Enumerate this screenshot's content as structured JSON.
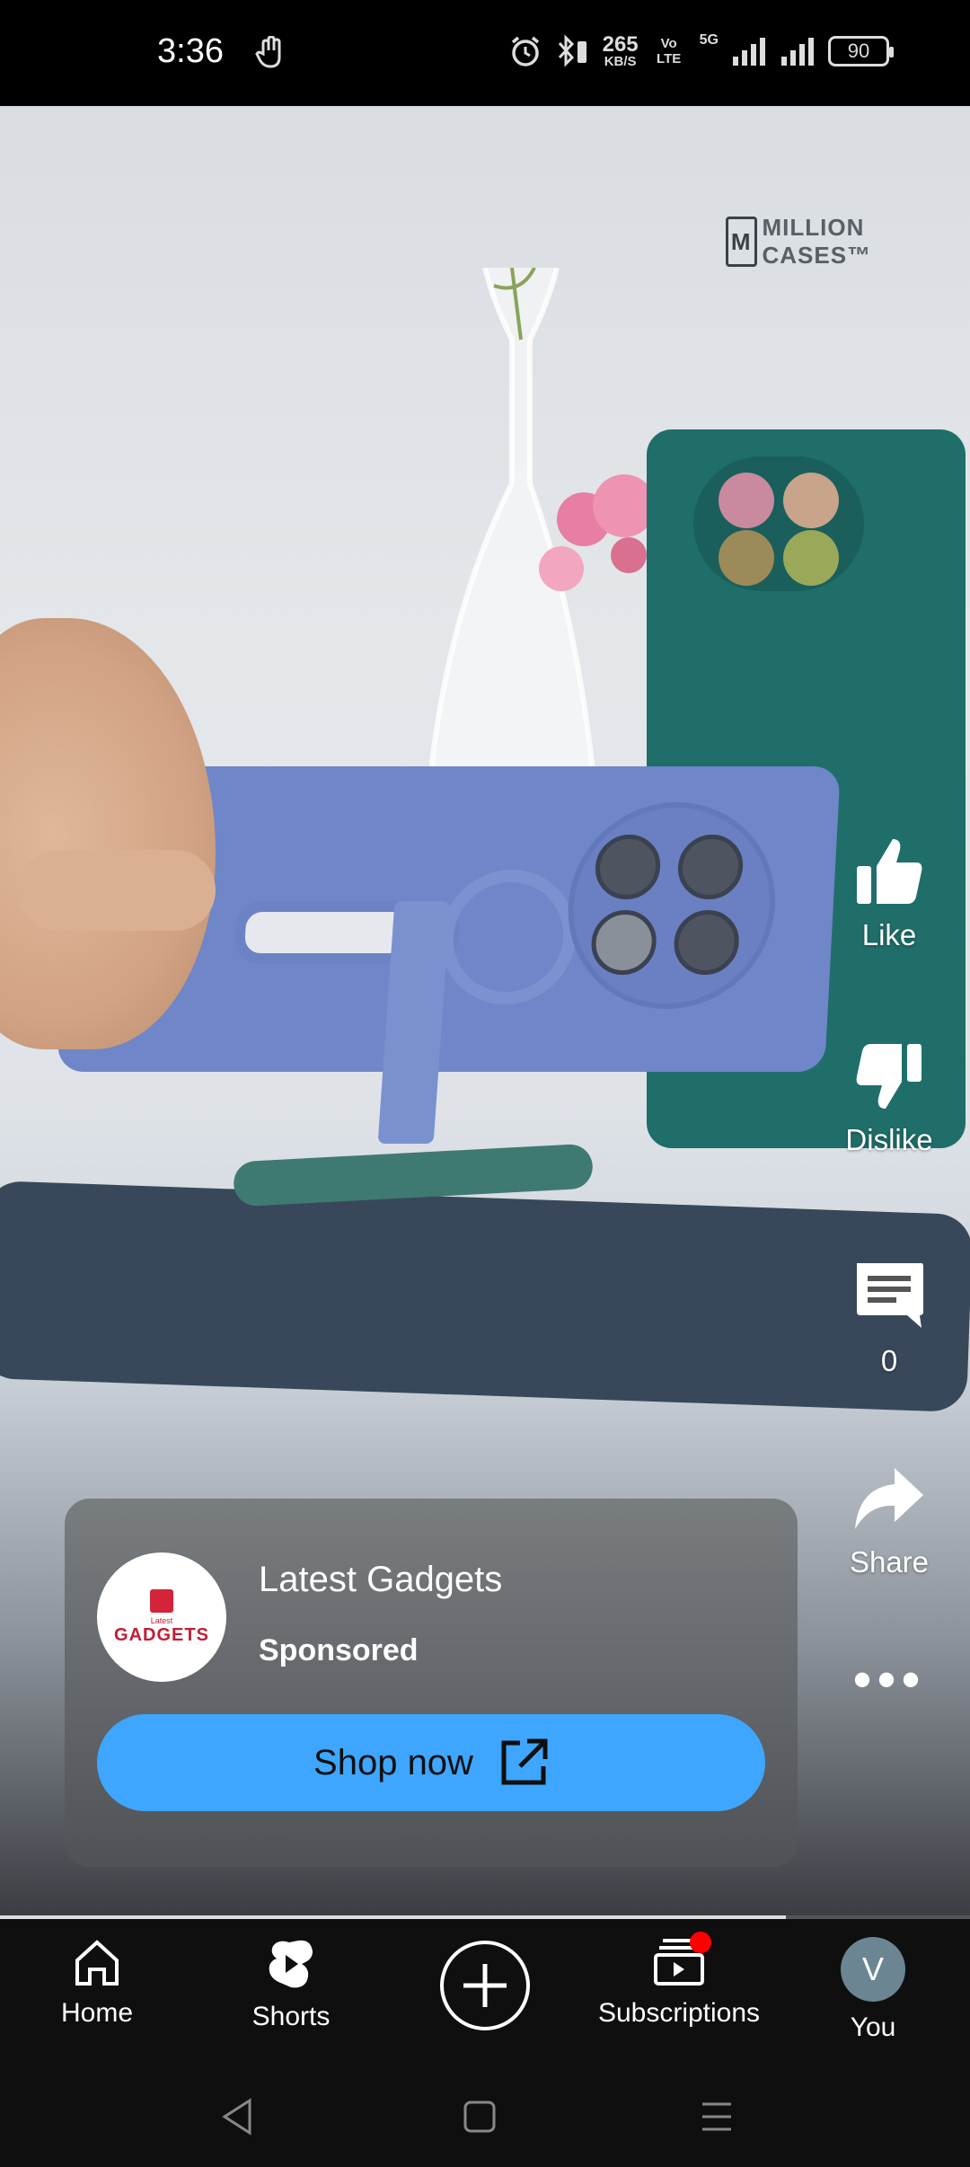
{
  "status_bar": {
    "time": "3:36",
    "net_speed_value": "265",
    "net_speed_unit": "KB/S",
    "volte": "VoLTE",
    "network": "5G",
    "battery": "90"
  },
  "video": {
    "watermark": "MILLION CASES™",
    "watermark_mark": "M"
  },
  "actions": {
    "like_label": "Like",
    "dislike_label": "Dislike",
    "comments_count": "0",
    "share_label": "Share",
    "more_label": "•••"
  },
  "ad": {
    "channel_name": "Latest Gadgets",
    "sponsored_label": "Sponsored",
    "logo_small": "Latest",
    "logo_text": "GADGETS",
    "cta_label": "Shop now"
  },
  "progress": {
    "fraction": 0.81
  },
  "bottom_nav": {
    "home": "Home",
    "shorts": "Shorts",
    "subscriptions": "Subscriptions",
    "you": "You",
    "avatar_initial": "V"
  },
  "colors": {
    "cta": "#3ea6ff",
    "nav_bg": "#0f0f0f",
    "notif": "#ff0000"
  }
}
